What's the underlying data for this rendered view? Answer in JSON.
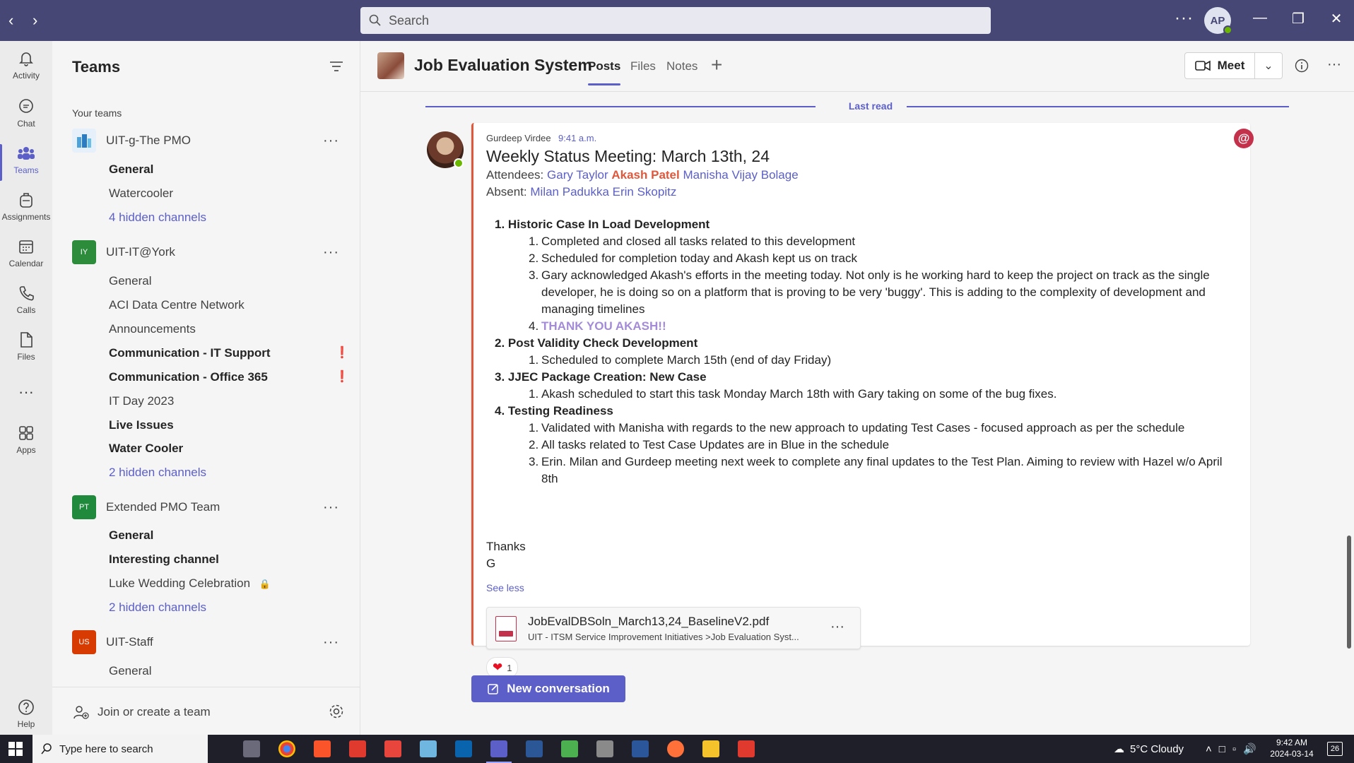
{
  "titlebar": {
    "search_placeholder": "Search",
    "avatar_initials": "AP",
    "more": "···"
  },
  "rail": [
    {
      "label": "Activity",
      "icon": "bell-icon"
    },
    {
      "label": "Chat",
      "icon": "chat-icon"
    },
    {
      "label": "Teams",
      "icon": "teams-icon",
      "active": true
    },
    {
      "label": "Assignments",
      "icon": "backpack-icon"
    },
    {
      "label": "Calendar",
      "icon": "calendar-icon"
    },
    {
      "label": "Calls",
      "icon": "phone-icon"
    },
    {
      "label": "Files",
      "icon": "file-icon"
    },
    {
      "label": "Apps",
      "icon": "apps-icon"
    },
    {
      "label": "Help",
      "icon": "help-icon"
    }
  ],
  "teams_pane": {
    "title": "Teams",
    "section_label": "Your teams",
    "teams": [
      {
        "name": "UIT-g-The PMO",
        "avatar": "",
        "color": "#ffffff",
        "channels": [
          {
            "label": "General",
            "bold": true
          },
          {
            "label": "Watercooler"
          },
          {
            "label": "4 hidden channels",
            "link": true
          }
        ]
      },
      {
        "name": "UIT-IT@York",
        "avatar": "IY",
        "color": "#2c8c3c",
        "channels": [
          {
            "label": "General"
          },
          {
            "label": "ACI Data Centre Network"
          },
          {
            "label": "Announcements"
          },
          {
            "label": "Communication - IT Support",
            "bold": true,
            "alert": true
          },
          {
            "label": "Communication - Office 365",
            "bold": true,
            "alert": true
          },
          {
            "label": "IT Day 2023"
          },
          {
            "label": "Live Issues",
            "bold": true
          },
          {
            "label": "Water Cooler",
            "bold": true
          },
          {
            "label": "2 hidden channels",
            "link": true
          }
        ]
      },
      {
        "name": "Extended PMO Team",
        "avatar": "PT",
        "color": "#1f8a3b",
        "channels": [
          {
            "label": "General",
            "bold": true
          },
          {
            "label": "Interesting channel",
            "bold": true
          },
          {
            "label": "Luke Wedding Celebration",
            "lock": true
          },
          {
            "label": "2 hidden channels",
            "link": true
          }
        ]
      },
      {
        "name": "UIT-Staff",
        "avatar": "US",
        "color": "#d83b01",
        "channels": [
          {
            "label": "General"
          }
        ]
      }
    ],
    "join_label": "Join or create a team"
  },
  "channel_header": {
    "title": "Job Evaluation System",
    "tabs": [
      "Posts",
      "Files",
      "Notes"
    ],
    "meet_label": "Meet"
  },
  "last_read": "Last read",
  "post": {
    "author": "Gurdeep Virdee",
    "time": "9:41 a.m.",
    "subject": "Weekly Status Meeting: March 13th, 24",
    "attendees_label": "Attendees:",
    "attendees": [
      "Gary Taylor",
      "Akash Patel",
      "Manisha Vijay Bolage"
    ],
    "absent_label": "Absent:",
    "absent": [
      "Milan Padukka",
      "Erin Skopitz"
    ],
    "sections": [
      {
        "num": "1.",
        "title": "Historic Case In Load Development",
        "items": [
          "Completed and closed all tasks related to this development",
          "Scheduled for completion today and Akash kept us on track",
          "Gary acknowledged Akash's efforts in the meeting today. Not only is he working hard to keep the project on track as the single developer, he is doing so on a platform that is proving to be very 'buggy'. This is adding to the complexity of development and managing timelines",
          "THANK YOU AKASH!!"
        ]
      },
      {
        "num": "2.",
        "title": "Post Validity Check Development",
        "items": [
          "Scheduled to complete March 15th (end of day Friday)"
        ]
      },
      {
        "num": "3.",
        "title": "JJEC Package Creation: New Case",
        "items": [
          "Akash scheduled to start this task Monday March 18th with Gary taking on some of the bug fixes."
        ]
      },
      {
        "num": "4.",
        "title": "Testing Readiness",
        "items": [
          "Validated with Manisha with regards to the new approach to updating Test Cases - focused approach as per the schedule",
          "All tasks related to Test Case Updates are in Blue in the schedule",
          "Erin. Milan and Gurdeep meeting next week to complete any final updates to the Test Plan. Aiming to review with Hazel w/o April 8th"
        ]
      }
    ],
    "closing_1": "Thanks",
    "closing_2": "G",
    "see_less": "See less",
    "attachment": {
      "name": "JobEvalDBSoln_March13,24_BaselineV2.pdf",
      "path": "UIT - ITSM Service Improvement Initiatives >Job Evaluation Syst..."
    },
    "reaction_count": "1"
  },
  "new_conversation": "New conversation",
  "taskbar": {
    "search_placeholder": "Type here to search",
    "weather": "5°C  Cloudy",
    "time": "9:42 AM",
    "date": "2024-03-14",
    "notifications": "26"
  },
  "colors": {
    "brand": "#5b5fc7",
    "titlebar": "#464775",
    "accent_orange": "#e0583b",
    "alert": "#c4314b"
  }
}
